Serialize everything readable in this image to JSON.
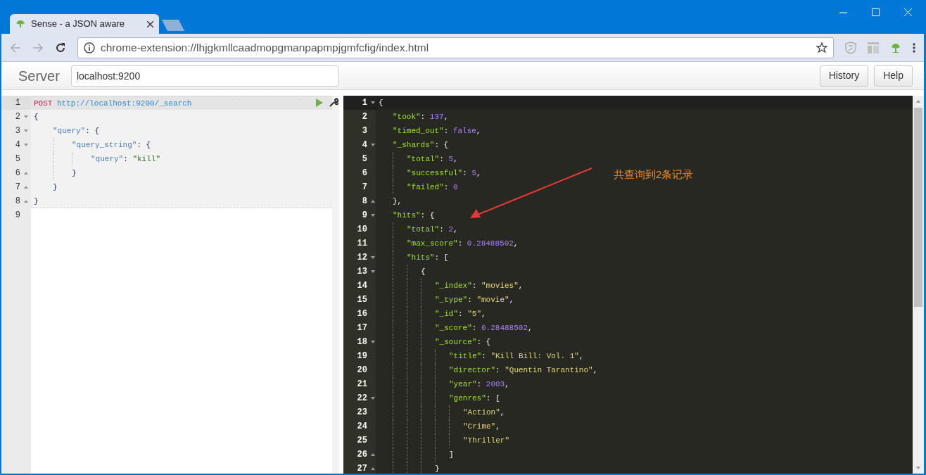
{
  "browser": {
    "tabs": [
      {
        "label": "Sense - a JSON aware",
        "selected": true
      },
      {
        "selected": false
      }
    ],
    "address": "chrome-extension://lhjgkmllcaadmopgmanpapmpjgmfcfig/index.html"
  },
  "app": {
    "brand": "Server",
    "server": "localhost:9200",
    "buttons": [
      "History",
      "Help"
    ]
  },
  "request_editor": {
    "lines": [
      {
        "number": "1",
        "fold_start": false,
        "fold_end": false,
        "active": true,
        "in_request": true,
        "code": [
          {
            "kind": "method",
            "text": "POST"
          },
          {
            "kind": "url",
            "text": "http://localhost:9200/_search"
          }
        ]
      },
      {
        "number": "2",
        "fold_start": true,
        "fold_end": false,
        "active": false,
        "in_request": true,
        "code": [
          {
            "kind": "punct",
            "text": "{"
          }
        ]
      },
      {
        "number": "3",
        "fold_start": true,
        "fold_end": false,
        "active": false,
        "in_request": true,
        "code": [
          {
            "kind": "key",
            "text": "    \"query\""
          },
          {
            "kind": "punct",
            "text": ": {"
          }
        ]
      },
      {
        "number": "4",
        "fold_start": true,
        "fold_end": false,
        "active": false,
        "in_request": true,
        "code": [
          {
            "kind": "key",
            "text": "        \"query_string\""
          },
          {
            "kind": "punct",
            "text": ": {"
          }
        ]
      },
      {
        "number": "5",
        "fold_start": false,
        "fold_end": false,
        "active": false,
        "in_request": true,
        "code": [
          {
            "kind": "key",
            "text": "            \"query\""
          },
          {
            "kind": "punct",
            "text": ": "
          },
          {
            "kind": "str",
            "text": "\"kill\""
          }
        ]
      },
      {
        "number": "6",
        "fold_start": false,
        "fold_end": true,
        "active": false,
        "in_request": true,
        "code": [
          {
            "kind": "punct",
            "text": "        }"
          }
        ]
      },
      {
        "number": "7",
        "fold_start": false,
        "fold_end": true,
        "active": false,
        "in_request": true,
        "code": [
          {
            "kind": "punct",
            "text": "    }"
          }
        ]
      },
      {
        "number": "8",
        "fold_start": false,
        "fold_end": true,
        "active": false,
        "in_request": true,
        "code": [
          {
            "kind": "punct",
            "text": "}"
          }
        ]
      },
      {
        "number": "9",
        "fold_start": false,
        "fold_end": false,
        "active": false,
        "in_request": false
      }
    ]
  },
  "response_editor": {
    "lines": [
      {
        "number": "1",
        "fold_start": true,
        "fold_end": false,
        "active": true,
        "code": [
          {
            "kind": "punct",
            "text": "{"
          }
        ]
      },
      {
        "number": "2",
        "fold_start": false,
        "fold_end": false,
        "active": false,
        "code": [
          {
            "kind": "key",
            "text": "  \"took\""
          },
          {
            "kind": "punct",
            "text": ": "
          },
          {
            "kind": "num",
            "text": "137"
          },
          {
            "kind": "punct",
            "text": ","
          }
        ]
      },
      {
        "number": "3",
        "fold_start": false,
        "fold_end": false,
        "active": false,
        "code": [
          {
            "kind": "key",
            "text": "  \"timed_out\""
          },
          {
            "kind": "punct",
            "text": ": "
          },
          {
            "kind": "num",
            "text": "false"
          },
          {
            "kind": "punct",
            "text": ","
          }
        ]
      },
      {
        "number": "4",
        "fold_start": true,
        "fold_end": false,
        "active": false,
        "code": [
          {
            "kind": "key",
            "text": "  \"_shards\""
          },
          {
            "kind": "punct",
            "text": ": {"
          }
        ]
      },
      {
        "number": "5",
        "fold_start": false,
        "fold_end": false,
        "active": false,
        "code": [
          {
            "kind": "key",
            "text": "    \"total\""
          },
          {
            "kind": "punct",
            "text": ": "
          },
          {
            "kind": "num",
            "text": "5"
          },
          {
            "kind": "punct",
            "text": ","
          }
        ]
      },
      {
        "number": "6",
        "fold_start": false,
        "fold_end": false,
        "active": false,
        "code": [
          {
            "kind": "key",
            "text": "    \"successful\""
          },
          {
            "kind": "punct",
            "text": ": "
          },
          {
            "kind": "num",
            "text": "5"
          },
          {
            "kind": "punct",
            "text": ","
          }
        ]
      },
      {
        "number": "7",
        "fold_start": false,
        "fold_end": false,
        "active": false,
        "code": [
          {
            "kind": "key",
            "text": "    \"failed\""
          },
          {
            "kind": "punct",
            "text": ": "
          },
          {
            "kind": "num",
            "text": "0"
          }
        ]
      },
      {
        "number": "8",
        "fold_start": false,
        "fold_end": true,
        "active": false,
        "code": [
          {
            "kind": "punct",
            "text": "  },"
          }
        ]
      },
      {
        "number": "9",
        "fold_start": true,
        "fold_end": false,
        "active": false,
        "code": [
          {
            "kind": "key",
            "text": "  \"hits\""
          },
          {
            "kind": "punct",
            "text": ": {"
          }
        ]
      },
      {
        "number": "10",
        "fold_start": false,
        "fold_end": false,
        "active": false,
        "code": [
          {
            "kind": "key",
            "text": "    \"total\""
          },
          {
            "kind": "punct",
            "text": ": "
          },
          {
            "kind": "num",
            "text": "2"
          },
          {
            "kind": "punct",
            "text": ","
          }
        ]
      },
      {
        "number": "11",
        "fold_start": false,
        "fold_end": false,
        "active": false,
        "code": [
          {
            "kind": "key",
            "text": "    \"max_score\""
          },
          {
            "kind": "punct",
            "text": ": "
          },
          {
            "kind": "num",
            "text": "0.28488502"
          },
          {
            "kind": "punct",
            "text": ","
          }
        ]
      },
      {
        "number": "12",
        "fold_start": true,
        "fold_end": false,
        "active": false,
        "code": [
          {
            "kind": "key",
            "text": "    \"hits\""
          },
          {
            "kind": "punct",
            "text": ": ["
          }
        ]
      },
      {
        "number": "13",
        "fold_start": true,
        "fold_end": false,
        "active": false,
        "code": [
          {
            "kind": "punct",
            "text": "      {"
          }
        ]
      },
      {
        "number": "14",
        "fold_start": false,
        "fold_end": false,
        "active": false,
        "code": [
          {
            "kind": "key",
            "text": "        \"_index\""
          },
          {
            "kind": "punct",
            "text": ": "
          },
          {
            "kind": "str",
            "text": "\"movies\""
          },
          {
            "kind": "punct",
            "text": ","
          }
        ]
      },
      {
        "number": "15",
        "fold_start": false,
        "fold_end": false,
        "active": false,
        "code": [
          {
            "kind": "key",
            "text": "        \"_type\""
          },
          {
            "kind": "punct",
            "text": ": "
          },
          {
            "kind": "str",
            "text": "\"movie\""
          },
          {
            "kind": "punct",
            "text": ","
          }
        ]
      },
      {
        "number": "16",
        "fold_start": false,
        "fold_end": false,
        "active": false,
        "code": [
          {
            "kind": "key",
            "text": "        \"_id\""
          },
          {
            "kind": "punct",
            "text": ": "
          },
          {
            "kind": "str",
            "text": "\"5\""
          },
          {
            "kind": "punct",
            "text": ","
          }
        ]
      },
      {
        "number": "17",
        "fold_start": false,
        "fold_end": false,
        "active": false,
        "code": [
          {
            "kind": "key",
            "text": "        \"_score\""
          },
          {
            "kind": "punct",
            "text": ": "
          },
          {
            "kind": "num",
            "text": "0.28488502"
          },
          {
            "kind": "punct",
            "text": ","
          }
        ]
      },
      {
        "number": "18",
        "fold_start": true,
        "fold_end": false,
        "active": false,
        "code": [
          {
            "kind": "key",
            "text": "        \"_source\""
          },
          {
            "kind": "punct",
            "text": ": {"
          }
        ]
      },
      {
        "number": "19",
        "fold_start": false,
        "fold_end": false,
        "active": false,
        "code": [
          {
            "kind": "key",
            "text": "          \"title\""
          },
          {
            "kind": "punct",
            "text": ": "
          },
          {
            "kind": "str",
            "text": "\"Kill Bill: Vol. 1\""
          },
          {
            "kind": "punct",
            "text": ","
          }
        ]
      },
      {
        "number": "20",
        "fold_start": false,
        "fold_end": false,
        "active": false,
        "code": [
          {
            "kind": "key",
            "text": "          \"director\""
          },
          {
            "kind": "punct",
            "text": ": "
          },
          {
            "kind": "str",
            "text": "\"Quentin Tarantino\""
          },
          {
            "kind": "punct",
            "text": ","
          }
        ]
      },
      {
        "number": "21",
        "fold_start": false,
        "fold_end": false,
        "active": false,
        "code": [
          {
            "kind": "key",
            "text": "          \"year\""
          },
          {
            "kind": "punct",
            "text": ": "
          },
          {
            "kind": "num",
            "text": "2003"
          },
          {
            "kind": "punct",
            "text": ","
          }
        ]
      },
      {
        "number": "22",
        "fold_start": true,
        "fold_end": false,
        "active": false,
        "code": [
          {
            "kind": "key",
            "text": "          \"genres\""
          },
          {
            "kind": "punct",
            "text": ": ["
          }
        ]
      },
      {
        "number": "23",
        "fold_start": false,
        "fold_end": false,
        "active": false,
        "code": [
          {
            "kind": "str",
            "text": "            \"Action\""
          },
          {
            "kind": "punct",
            "text": ","
          }
        ]
      },
      {
        "number": "24",
        "fold_start": false,
        "fold_end": false,
        "active": false,
        "code": [
          {
            "kind": "str",
            "text": "            \"Crime\""
          },
          {
            "kind": "punct",
            "text": ","
          }
        ]
      },
      {
        "number": "25",
        "fold_start": false,
        "fold_end": false,
        "active": false,
        "code": [
          {
            "kind": "str",
            "text": "            \"Thriller\""
          }
        ]
      },
      {
        "number": "26",
        "fold_start": false,
        "fold_end": true,
        "active": false,
        "code": [
          {
            "kind": "punct",
            "text": "          ]"
          }
        ]
      },
      {
        "number": "27",
        "fold_start": false,
        "fold_end": true,
        "active": false,
        "code": [
          {
            "kind": "punct",
            "text": "        }"
          }
        ]
      }
    ]
  },
  "annotation": {
    "text": "共查询到2条记录"
  }
}
